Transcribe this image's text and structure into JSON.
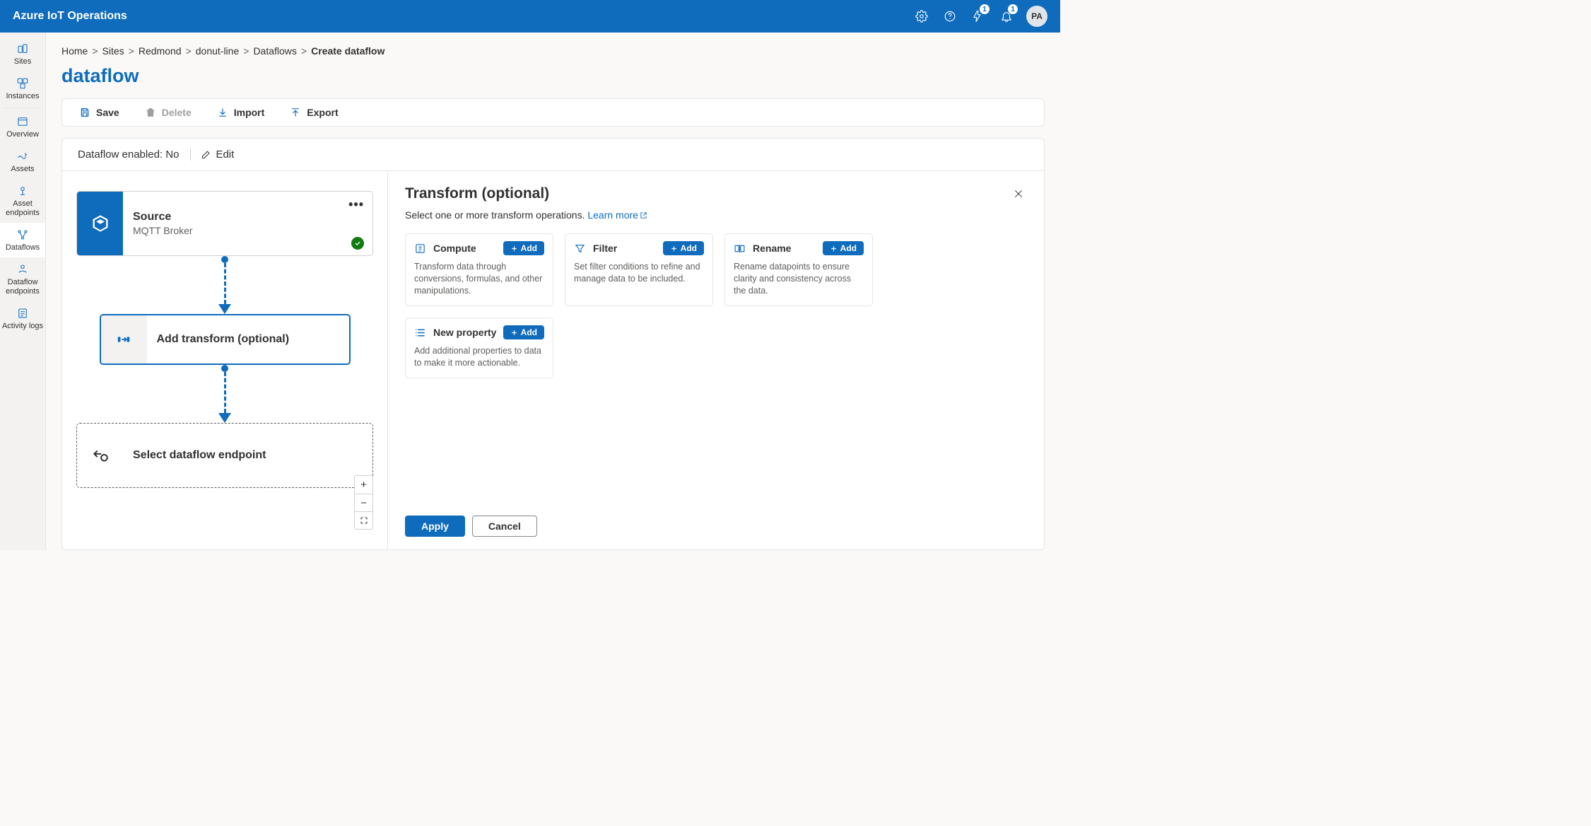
{
  "header": {
    "title": "Azure IoT Operations",
    "badge1": "1",
    "badge2": "1",
    "avatar": "PA"
  },
  "sidebar": {
    "items": [
      {
        "label": "Sites"
      },
      {
        "label": "Instances"
      },
      {
        "label": "Overview"
      },
      {
        "label": "Assets"
      },
      {
        "label": "Asset endpoints"
      },
      {
        "label": "Dataflows"
      },
      {
        "label": "Dataflow endpoints"
      },
      {
        "label": "Activity logs"
      }
    ]
  },
  "breadcrumb": {
    "items": [
      "Home",
      "Sites",
      "Redmond",
      "donut-line",
      "Dataflows"
    ],
    "current": "Create dataflow"
  },
  "page": {
    "title": "dataflow"
  },
  "toolbar": {
    "save": "Save",
    "delete": "Delete",
    "import": "Import",
    "export": "Export"
  },
  "status": {
    "label": "Dataflow enabled:",
    "value": "No",
    "edit": "Edit"
  },
  "canvas": {
    "source_title": "Source",
    "source_sub": "MQTT Broker",
    "transform_title": "Add transform (optional)",
    "dest_title": "Select dataflow endpoint"
  },
  "panel": {
    "title": "Transform (optional)",
    "desc_prefix": "Select one or more transform operations. ",
    "learn": "Learn more",
    "add_label": "Add",
    "cards": [
      {
        "title": "Compute",
        "desc": "Transform data through conversions, formulas, and other manipulations."
      },
      {
        "title": "Filter",
        "desc": "Set filter conditions to refine and manage data to be included."
      },
      {
        "title": "Rename",
        "desc": "Rename datapoints to ensure clarity and consistency across the data."
      },
      {
        "title": "New property",
        "desc": "Add additional properties to data to make it more actionable."
      }
    ],
    "apply": "Apply",
    "cancel": "Cancel"
  }
}
